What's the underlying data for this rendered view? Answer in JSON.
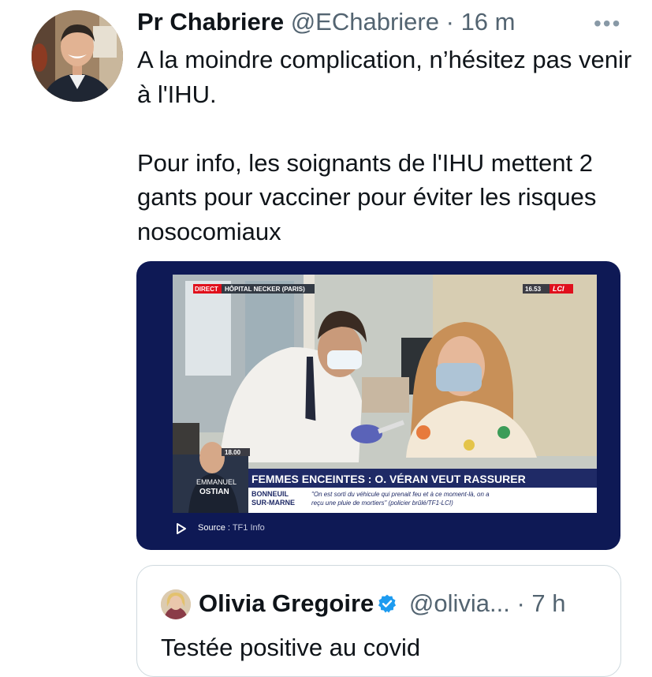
{
  "tweet": {
    "author_name": "Pr Chabriere",
    "author_handle": "@EChabriere",
    "separator": "·",
    "time": "16 m",
    "more_label": "•••",
    "paragraphs": [
      "A la moindre complication, n’hésitez pas venir à l'IHU.",
      "Pour info, les soignants de l'IHU mettent 2 gants pour vacciner pour éviter les risques nosocomiaux"
    ]
  },
  "media": {
    "direct_label": "DIRECT",
    "location_label": "HÔPITAL NECKER (PARIS)",
    "clock": "16.53",
    "channel_logo": "LCI",
    "presenter_time": "18.00",
    "presenter_first": "EMMANUEL",
    "presenter_last": "OSTIAN",
    "headline": "FEMMES ENCEINTES : O. VÉRAN VEUT RASSURER",
    "ticker_place_1": "BONNEUIL",
    "ticker_place_2": "SUR-MARNE",
    "ticker_text_1": "\"On est sorti du véhicule qui prenait feu et à ce moment-là, on a",
    "ticker_text_2": "reçu une pluie de mortiers\" (policier brûlé/TF1-LCI)",
    "source_label": "Source :",
    "source_value": "TF1 Info",
    "play_icon": "play-icon"
  },
  "quoted": {
    "author_name": "Olivia Gregoire",
    "verified_icon": "verified-badge-icon",
    "author_handle": "@olivia...",
    "separator": "·",
    "time": "7 h",
    "text": "Testée positive au covid"
  },
  "colors": {
    "accent": "#1d9bf0",
    "media_background": "#0e1955",
    "lci_red": "#e0101c",
    "secondary_text": "#536471"
  }
}
